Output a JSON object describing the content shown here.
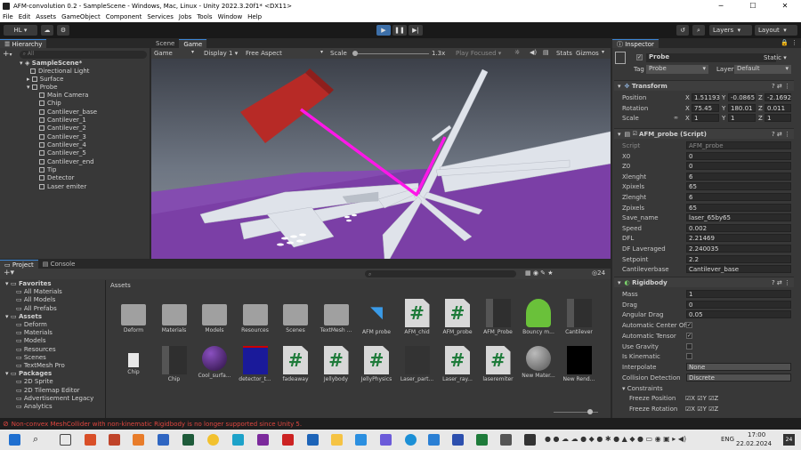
{
  "window": {
    "title": "AFM-convolution 0.2 - SampleScene - Windows, Mac, Linux - Unity 2022.3.20f1* <DX11>"
  },
  "menu": [
    "File",
    "Edit",
    "Assets",
    "GameObject",
    "Component",
    "Services",
    "Jobs",
    "Tools",
    "Window",
    "Help"
  ],
  "toolbar": {
    "account": "HL",
    "layers": "Layers",
    "layout": "Layout"
  },
  "hierarchy": {
    "tab": "Hierarchy",
    "search_placeholder": "All",
    "scene": "SampleScene*",
    "items": [
      "Directional Light",
      "Surface",
      "Probe",
      "Main Camera",
      "Chip",
      "Cantilever_base",
      "Cantilever_1",
      "Cantilever_2",
      "Cantilever_3",
      "Cantilever_4",
      "Cantilever_5",
      "Cantilever_end",
      "Tip",
      "Detector",
      "Laser emiter"
    ]
  },
  "scene_tabs": [
    "Scene",
    "Game"
  ],
  "game_bar": {
    "mode": "Game",
    "display": "Display 1",
    "aspect": "Free Aspect",
    "scale_label": "Scale",
    "scale_value": "1.3x",
    "play_focused": "Play Focused",
    "stats": "Stats",
    "gizmos": "Gizmos"
  },
  "inspector": {
    "tab": "Inspector",
    "object_name": "Probe",
    "static": "Static",
    "tag_label": "Tag",
    "tag": "Probe",
    "layer_label": "Layer",
    "layer": "Default",
    "transform": {
      "title": "Transform",
      "position_label": "Position",
      "position": [
        "1.51193",
        "-0.0865",
        "-2.1692"
      ],
      "rotation_label": "Rotation",
      "rotation": [
        "75.45",
        "180.01",
        "0.011"
      ],
      "scale_label": "Scale",
      "scale": [
        "1",
        "1",
        "1"
      ]
    },
    "afm": {
      "title": "AFM_probe (Script)",
      "fields": [
        {
          "label": "Script",
          "value": "AFM_probe"
        },
        {
          "label": "X0",
          "value": "0"
        },
        {
          "label": "Z0",
          "value": "0"
        },
        {
          "label": "Xlenght",
          "value": "6"
        },
        {
          "label": "Xpixels",
          "value": "65"
        },
        {
          "label": "Zlenght",
          "value": "6"
        },
        {
          "label": "Zpixels",
          "value": "65"
        },
        {
          "label": "Save_name",
          "value": "laser_65by65"
        },
        {
          "label": "Speed",
          "value": "0.002"
        },
        {
          "label": "DFL",
          "value": "2.21469"
        },
        {
          "label": "DF Laveraged",
          "value": "2.240035"
        },
        {
          "label": "Setpoint",
          "value": "2.2"
        },
        {
          "label": "Cantileverbase",
          "value": "Cantilever_base"
        }
      ]
    },
    "rigidbody": {
      "title": "Rigidbody",
      "fields": [
        {
          "label": "Mass",
          "value": "1"
        },
        {
          "label": "Drag",
          "value": "0"
        },
        {
          "label": "Angular Drag",
          "value": "0.05"
        },
        {
          "label": "Automatic Center Of",
          "value": ""
        },
        {
          "label": "Automatic Tensor",
          "value": ""
        },
        {
          "label": "Use Gravity",
          "value": ""
        },
        {
          "label": "Is Kinematic",
          "value": ""
        },
        {
          "label": "Interpolate",
          "value": "None"
        },
        {
          "label": "Collision Detection",
          "value": "Discrete"
        }
      ],
      "constraints_label": "Constraints",
      "freeze_position": "Freeze Position",
      "freeze_rotation": "Freeze Rotation",
      "axes": [
        "X",
        "Y",
        "Z"
      ]
    }
  },
  "project": {
    "tabs": [
      "Project",
      "Console"
    ],
    "assets_header": "Assets",
    "count": "24",
    "tree": [
      {
        "label": "Favorites",
        "bold": true
      },
      {
        "label": "All Materials"
      },
      {
        "label": "All Models"
      },
      {
        "label": "All Prefabs"
      },
      {
        "label": "Assets",
        "bold": true
      },
      {
        "label": "Deform"
      },
      {
        "label": "Materials"
      },
      {
        "label": "Models"
      },
      {
        "label": "Resources"
      },
      {
        "label": "Scenes"
      },
      {
        "label": "TextMesh Pro"
      },
      {
        "label": "Packages",
        "bold": true
      },
      {
        "label": "2D Sprite"
      },
      {
        "label": "2D Tilemap Editor"
      },
      {
        "label": "Advertisement Legacy"
      },
      {
        "label": "Analytics"
      }
    ],
    "row1": [
      "Deform",
      "Materials",
      "Models",
      "Resources",
      "Scenes",
      "TextMesh ...",
      "AFM probe",
      "AFM_chid",
      "AFM_probe",
      "AFM_Probe",
      "Bouncy m...",
      "Cantilever"
    ],
    "row2": [
      "Chip",
      "Chip",
      "Cool_surfa...",
      "detector_t...",
      "fadeaway",
      "Jellybody",
      "JellyPhysics",
      "Laser_part...",
      "Laser_ray...",
      "laseremiter",
      "New Mater...",
      "New Rend..."
    ]
  },
  "status": {
    "message": "Non-convex MeshCollider with non-kinematic Rigidbody is no longer supported since Unity 5."
  },
  "taskbar": {
    "lang": "ENG",
    "time": "17:00",
    "date": "22.02.2024",
    "badge": "24"
  }
}
